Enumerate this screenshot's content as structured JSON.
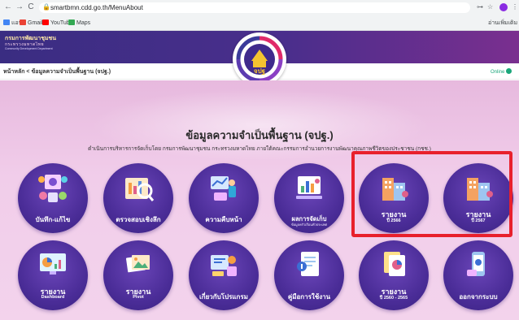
{
  "browser": {
    "url": "smartbmn.cdd.go.th/MenuAbout",
    "bookmarks": [
      "แอป",
      "Gmail",
      "YouTube",
      "Maps"
    ],
    "reading_list": "อ่านเพิ่มเติม",
    "nav_back": "←",
    "nav_forward": "→",
    "nav_reload": "C",
    "lock": "🔒",
    "ext_key": "⊶",
    "ext_star": "☆",
    "ext_menu": "⋮"
  },
  "header": {
    "dept_th": "กรมการพัฒนาชุมชน",
    "dept_sub": "กระทรวงมหาดไทย",
    "dept_en": "Community Development Department",
    "breadcrumb": "หน้าหลัก < ข้อมูลความจำเป็นพื้นฐาน (จปฐ.)",
    "online": "Online",
    "logo_text": "จปฐ"
  },
  "main": {
    "title": "ข้อมูลความจำเป็นพื้นฐาน (จปฐ.)",
    "subtitle": "ดำเนินการบริหารการจัดเก็บโดย กรมการพัฒนาชุมชน กระทรวงมหาดไทย ภายใต้คณะกรรมการอำนวยการงานพัฒนาคุณภาพชีวิตของประชาชน (กชช.)"
  },
  "tiles": [
    {
      "label": "บันทึก-แก้ไข",
      "icon": "people-network-icon"
    },
    {
      "label": "ตรวจสอบเชิงลึก",
      "icon": "magnifier-report-icon"
    },
    {
      "label": "ความคืบหน้า",
      "icon": "progress-person-icon"
    },
    {
      "label": "ผลการจัดเก็บ",
      "sub": "ข้อมูลครัวเรือนทั่วประเทศ",
      "icon": "chart-board-icon"
    },
    {
      "label": "รายงาน",
      "sub": "ปี 2566",
      "icon": "building-report-icon"
    },
    {
      "label": "รายงาน",
      "sub": "ปี 2567",
      "icon": "building-report-icon"
    },
    {
      "label": "รายงาน",
      "sub": "Dashboard",
      "icon": "dashboard-monitor-icon"
    },
    {
      "label": "รายงาน",
      "sub": "Pivot",
      "icon": "pivot-photos-icon"
    },
    {
      "label": "เกี่ยวกับโปรแกรม",
      "icon": "program-info-icon"
    },
    {
      "label": "คู่มือการใช้งาน",
      "icon": "manual-book-icon"
    },
    {
      "label": "รายงาน",
      "sub": "ปี 2560 - 2565",
      "icon": "report-docs-icon"
    },
    {
      "label": "ออกจากระบบ",
      "icon": "logout-phone-icon"
    }
  ],
  "colors": {
    "tile_bg": "#4b2d98",
    "header_bg": "#3a2d82",
    "highlight": "#e8202c",
    "content_bg": "#f1cdea"
  }
}
